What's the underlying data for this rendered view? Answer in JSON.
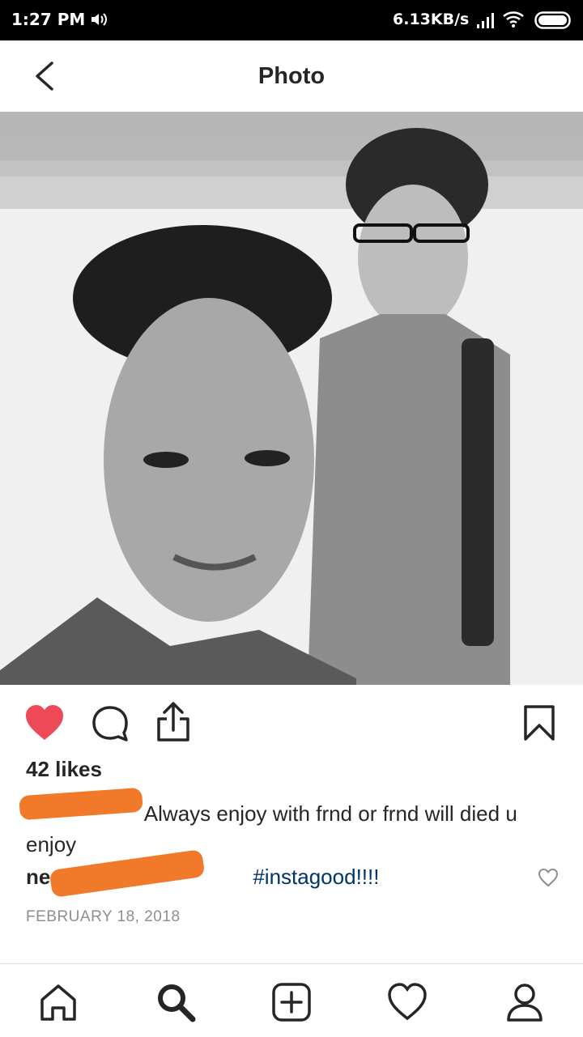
{
  "status_bar": {
    "time": "1:27 PM",
    "network_speed": "6.13KB/s"
  },
  "header": {
    "title": "Photo"
  },
  "post": {
    "likes": "42 likes",
    "caption_text": "Always enjoy with frnd or frnd will died u enjoy",
    "comment_user_visible": "ne",
    "comment_hashtag": "#instagood!!!!",
    "date": "FEBRUARY 18, 2018"
  },
  "icons": {
    "back": "back-arrow-icon",
    "like": "heart-filled-icon",
    "comment": "comment-bubble-icon",
    "share": "share-icon",
    "save": "bookmark-icon",
    "comment_like": "heart-outline-icon",
    "nav": [
      "home-icon",
      "search-icon",
      "add-post-icon",
      "activity-heart-icon",
      "profile-icon"
    ]
  },
  "colors": {
    "like_red": "#ed4956",
    "hashtag_blue": "#003569",
    "date_gray": "#8e8e8e",
    "redaction_orange": "#f07a2a"
  }
}
